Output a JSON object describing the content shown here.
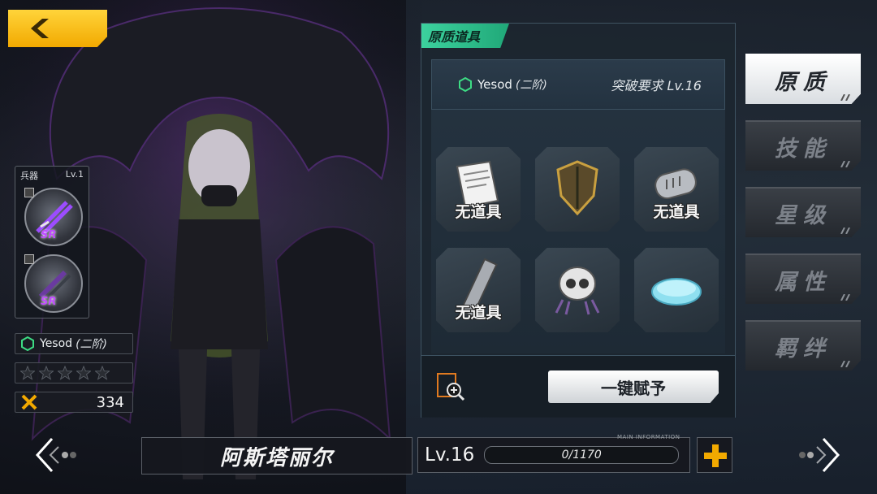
{
  "back_button": {
    "icon": "chevron-left-icon"
  },
  "weapon_panel": {
    "label": "兵器",
    "level": "Lv.1",
    "slots": [
      {
        "rarity": "SR",
        "icon": "weapon-icon"
      },
      {
        "rarity": "SR",
        "icon": "weapon-icon"
      }
    ]
  },
  "character_info": {
    "class_name": "Yesod",
    "class_tier": "(二阶)",
    "stars": 0,
    "stars_max": 5,
    "power": "334"
  },
  "item_panel": {
    "tab_label": "原质道具",
    "requirement": {
      "class_name": "Yesod",
      "class_tier": "(二阶)",
      "text": "突破要求 Lv.16"
    },
    "items": [
      {
        "name": "book-item",
        "label": "无道具",
        "flag": ""
      },
      {
        "name": "shield-item",
        "label": "",
        "flag": "green"
      },
      {
        "name": "battery-item",
        "label": "无道具",
        "flag": ""
      },
      {
        "name": "ruler-item",
        "label": "无道具",
        "flag": ""
      },
      {
        "name": "skull-item",
        "label": "",
        "flag": "white"
      },
      {
        "name": "soap-item",
        "label": "",
        "flag": "white"
      }
    ],
    "assign_button": "一键赋予"
  },
  "side_tabs": [
    {
      "label": "原质",
      "active": true
    },
    {
      "label": "技能",
      "active": false
    },
    {
      "label": "星级",
      "active": false
    },
    {
      "label": "属性",
      "active": false
    },
    {
      "label": "羁绊",
      "active": false
    }
  ],
  "bottom": {
    "character_name": "阿斯塔丽尔",
    "level": "Lv.16",
    "exp": "0/1170",
    "exp_fraction": 0,
    "main_info": "MAIN INFORMATION"
  },
  "colors": {
    "accent_yellow": "#f2a900",
    "accent_green": "#2fc48e",
    "sr_purple": "#c14cff"
  }
}
